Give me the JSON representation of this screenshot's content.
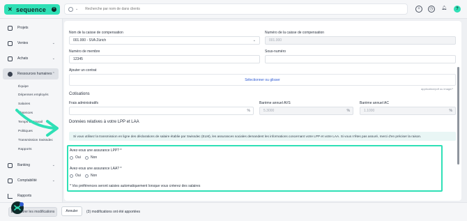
{
  "app": {
    "brand": "sequence",
    "search_placeholder": "Recherche par nom de dans clients"
  },
  "colors": {
    "accent": "#2fe0b6",
    "link": "#2f5bd3",
    "notice_bg": "#e9f6f5"
  },
  "sidebar": {
    "items": [
      {
        "label": "Projets",
        "icon": "check-square-icon"
      },
      {
        "label": "Ventes",
        "icon": "receipt-icon"
      },
      {
        "label": "Achats",
        "icon": "lock-icon"
      },
      {
        "label": "Ressources humaines",
        "icon": "user-circle-icon"
      },
      {
        "label": "Banking",
        "icon": "bank-icon"
      },
      {
        "label": "Comptabilité",
        "icon": "calculator-icon"
      },
      {
        "label": "Rapports",
        "icon": "chart-icon"
      }
    ],
    "subitems": [
      "Équipe",
      "Dépenses employés",
      "Salaires",
      "Absences",
      "Temps de travail",
      "Politiques",
      "Transmission Swissdec",
      "Rapports"
    ]
  },
  "form": {
    "caisse_label": "Nom de la caisse de compensation",
    "caisse_value": "001.000 - SVA Zürich",
    "numero_caisse_label": "Numéro de la caisse de compensation",
    "numero_caisse_value": "001.000",
    "membre_label": "Numéro de membre",
    "membre_value": "12345",
    "sous_numero_label": "Sous-numéro",
    "sous_numero_value": "",
    "contrat_label": "Ajouter un contrat",
    "contrat_button": "Sélectionner ou glisser",
    "contrat_hint": "application/pdf ou image/*",
    "cotisations_title": "Cotisations",
    "frais_label": "Frais administratifs",
    "frais_value": "",
    "frais_unit": "%",
    "avs_label": "Barème annuel AVS",
    "avs_value": "5.3000",
    "avs_unit": "%",
    "ac_label": "Barème annuel AC",
    "ac_value": "1.1000",
    "ac_unit": "%",
    "lpp_section_title": "Données relatives à votre LPP et LAA",
    "notice": "Si vous utilisez la transmission en ligne des déclarations de salaire établie par Swissdec (ELM), les assurances sociales demandent les informations concernant votre LPP et votre LAA. Si vous n'êtes pas assuré, merci d'en préciser la raison.",
    "lpp_question": "Avez-vous une assurance LPP? *",
    "laa_question": "Avez-vous une assurance LAA? *",
    "oui": "Oui",
    "non": "Non",
    "footnote": "* Vos préférences seront saisies automatiquement lorsque vous créerez des salaires"
  },
  "footer": {
    "save_label": "Enregistrer les modifications",
    "cancel_label": "Annuler",
    "changes_text": "(3) modifications ont été apportées"
  }
}
